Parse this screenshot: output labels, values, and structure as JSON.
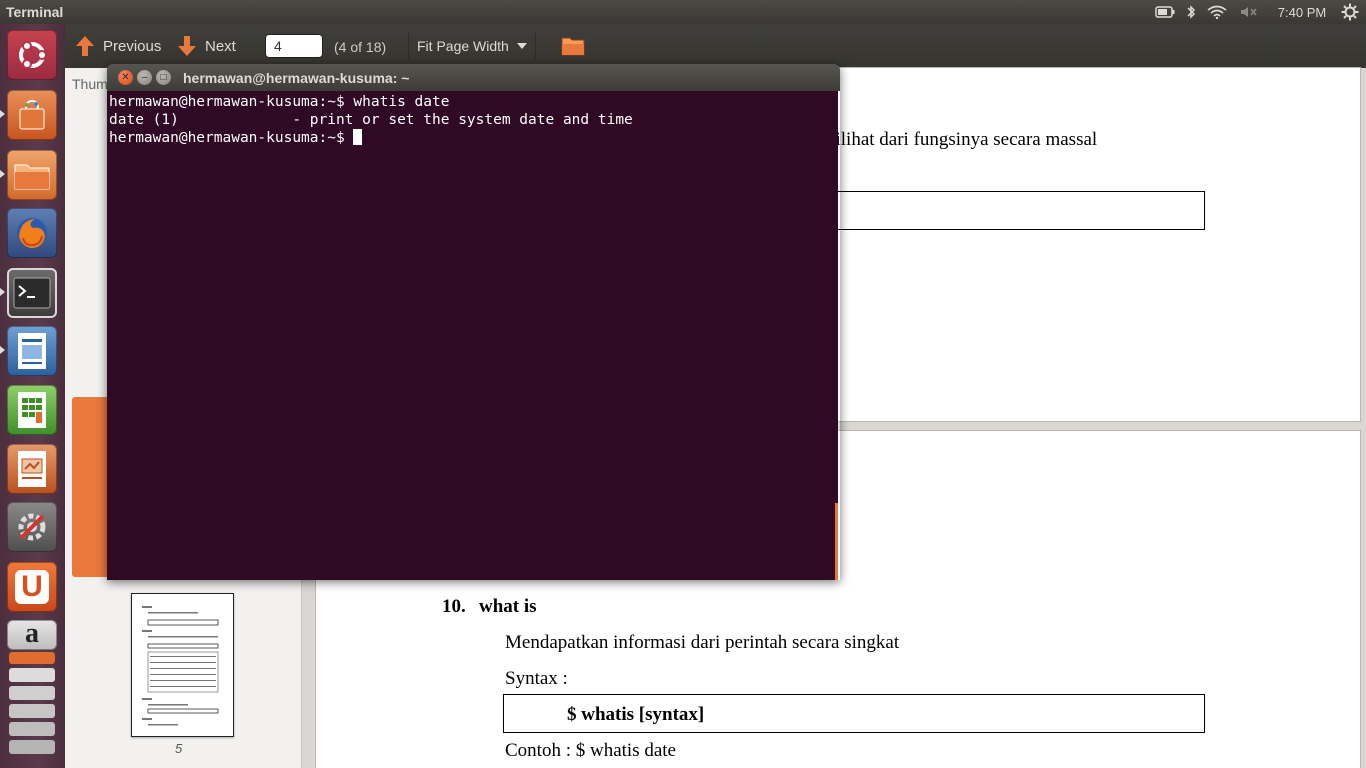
{
  "top_panel": {
    "app_title": "Terminal",
    "clock": "7:40 PM",
    "icons": [
      "battery-icon",
      "bluetooth-icon",
      "wifi-icon",
      "volume-muted-icon",
      "gear-icon"
    ]
  },
  "launcher": {
    "items": [
      {
        "name": "dash-home",
        "icon": "ubuntu-logo-icon"
      },
      {
        "name": "software-center",
        "icon": "shopping-bag-icon"
      },
      {
        "name": "files",
        "icon": "folder-icon"
      },
      {
        "name": "firefox",
        "icon": "firefox-icon"
      },
      {
        "name": "terminal",
        "icon": "terminal-icon"
      },
      {
        "name": "writer",
        "icon": "writer-icon"
      },
      {
        "name": "calc",
        "icon": "calc-icon"
      },
      {
        "name": "impress",
        "icon": "impress-icon"
      },
      {
        "name": "system-settings",
        "icon": "settings-icon"
      },
      {
        "name": "ubuntu-one",
        "icon": "ubuntu-one-icon"
      },
      {
        "name": "amazon",
        "icon": "amazon-icon"
      },
      {
        "name": "workspaces",
        "icon": "workspaces-icon"
      }
    ],
    "ubuntu_one_letter": "U",
    "amazon_letter": "a"
  },
  "viewer": {
    "previous_label": "Previous",
    "next_label": "Next",
    "page_input": "4",
    "page_count": "(4 of 18)",
    "zoom": "Fit Page Width",
    "sidebar_header": "Thum",
    "thumb_label": "5"
  },
  "document": {
    "partial_line": "dilihat dari fungsinya secara massal",
    "section_number": "10.",
    "section_title": "what is",
    "description": "Mendapatkan informasi dari perintah secara singkat",
    "syntax_label": "Syntax :",
    "syntax_code": "$ whatis [syntax]",
    "example": "Contoh : $ whatis date"
  },
  "terminal": {
    "title": "hermawan@hermawan-kusuma: ~",
    "lines": [
      "hermawan@hermawan-kusuma:~$ whatis date",
      "date (1)             - print or set the system date and time",
      "hermawan@hermawan-kusuma:~$ "
    ]
  },
  "colors": {
    "terminal_bg": "#300a24",
    "accent": "#e8783c",
    "panel": "#3c3b37"
  }
}
